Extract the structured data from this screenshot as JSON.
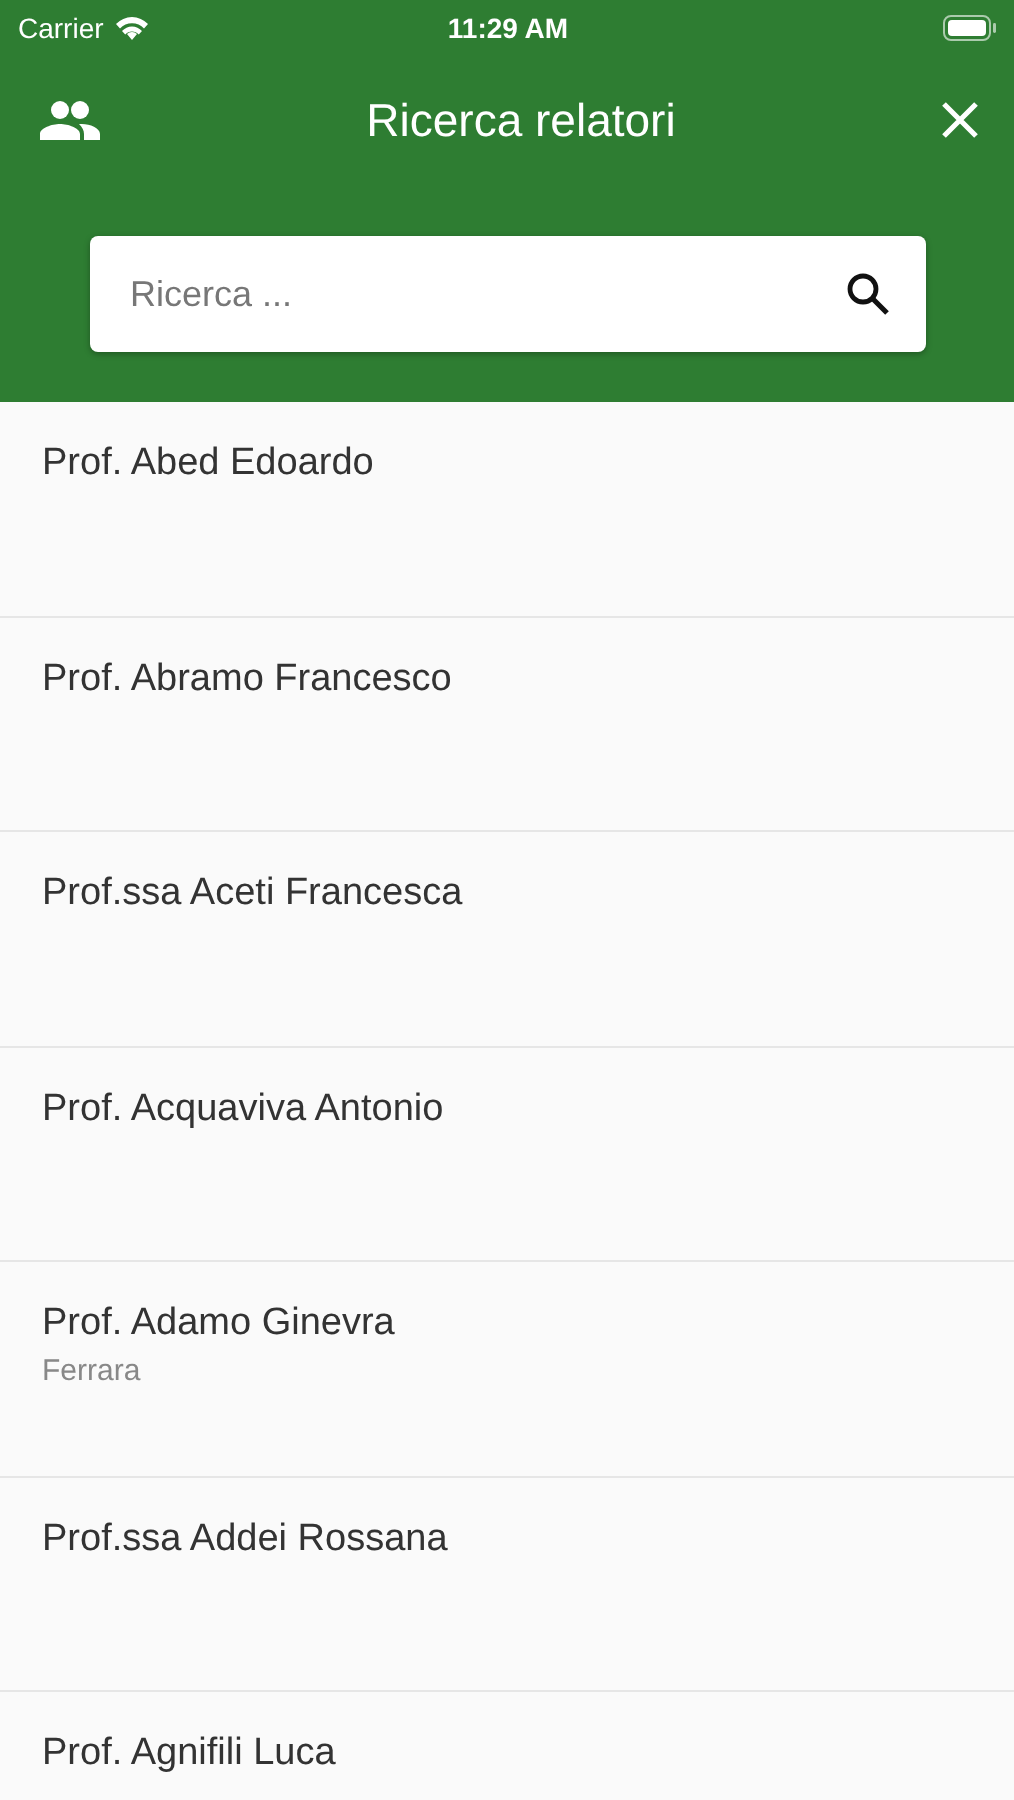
{
  "status_bar": {
    "carrier": "Carrier",
    "time": "11:29 AM"
  },
  "header": {
    "title": "Ricerca relatori"
  },
  "search": {
    "placeholder": "Ricerca ..."
  },
  "rows": [
    {
      "name": "Prof. Abed Edoardo"
    },
    {
      "name": "Prof. Abramo Francesco"
    },
    {
      "name": "Prof.ssa Aceti Francesca"
    },
    {
      "name": "Prof. Acquaviva Antonio"
    },
    {
      "name": "Prof. Adamo Ginevra",
      "subtitle": "Ferrara"
    },
    {
      "name": "Prof.ssa Addei Rossana"
    },
    {
      "name": "Prof. Agnifili Luca"
    }
  ]
}
